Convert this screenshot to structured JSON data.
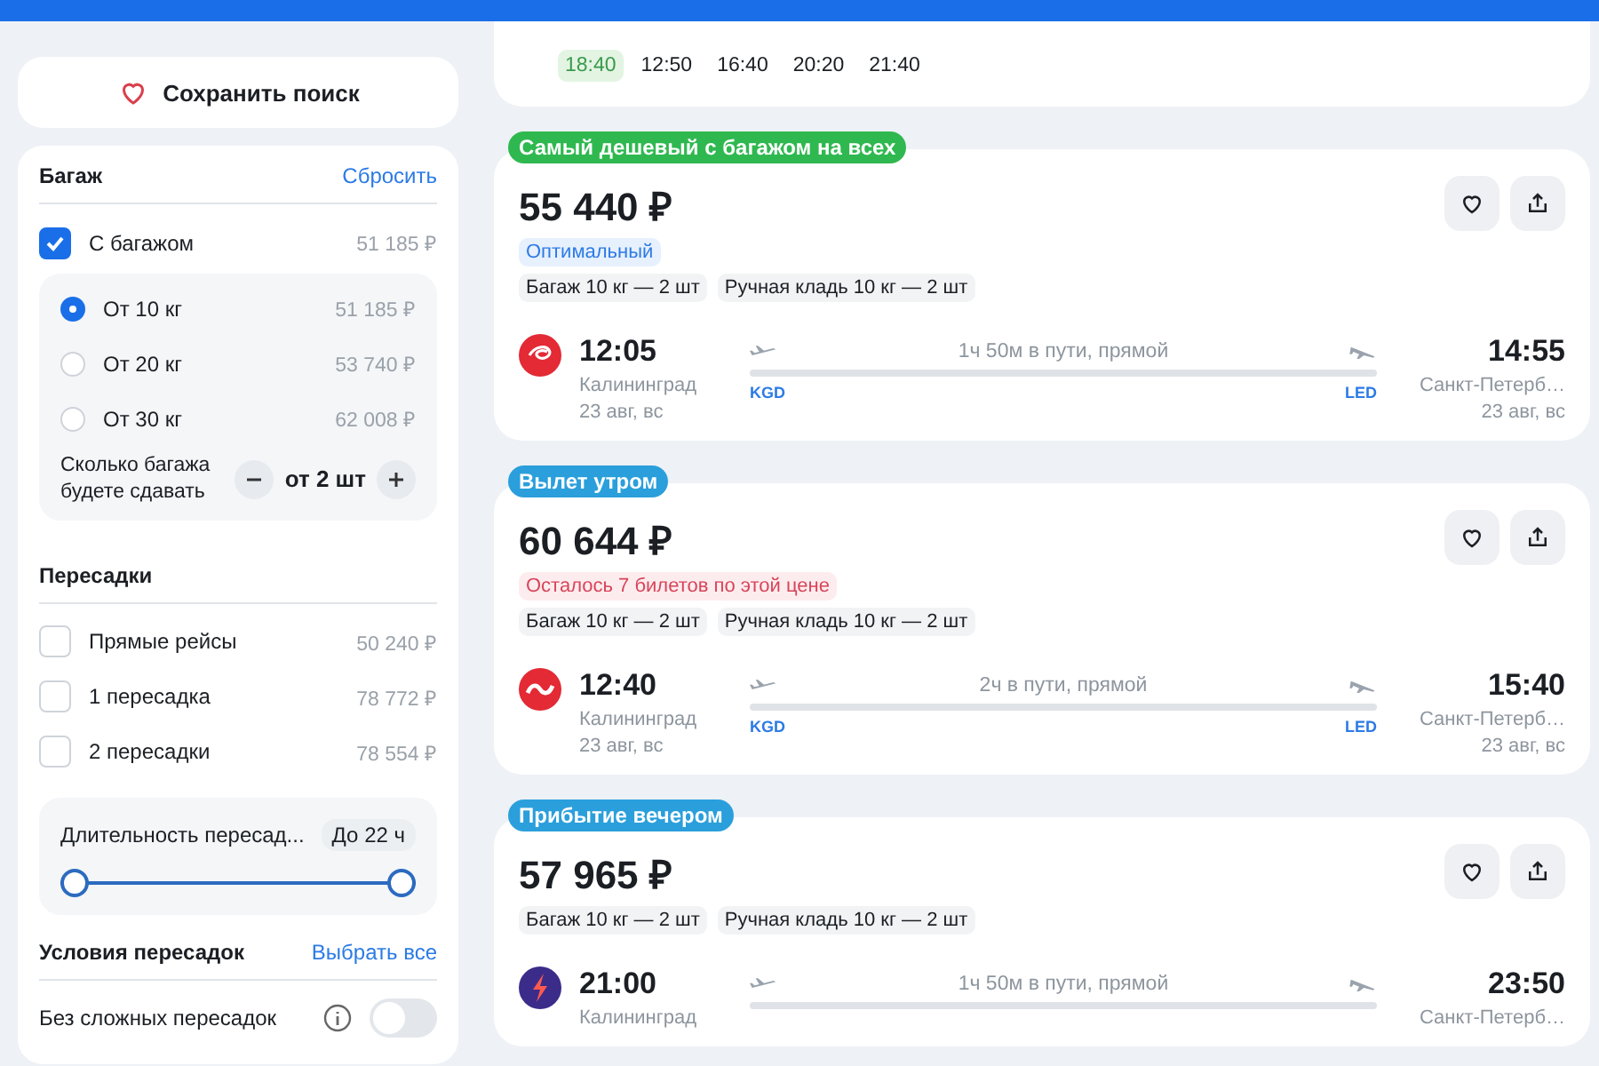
{
  "prev_card": {
    "times": [
      {
        "label": "18:40",
        "selected": true
      },
      {
        "label": "12:50",
        "selected": false
      },
      {
        "label": "16:40",
        "selected": false
      },
      {
        "label": "20:20",
        "selected": false
      },
      {
        "label": "21:40",
        "selected": false
      }
    ]
  },
  "sidebar": {
    "save_button": "Сохранить поиск",
    "baggage": {
      "title": "Багаж",
      "reset": "Сбросить",
      "with_baggage": {
        "label": "С багажом",
        "price": "51 185 ₽",
        "checked": true
      },
      "weights": [
        {
          "label": "От 10 кг",
          "price": "51 185 ₽",
          "selected": true
        },
        {
          "label": "От 20 кг",
          "price": "53 740 ₽",
          "selected": false
        },
        {
          "label": "От 30 кг",
          "price": "62 008 ₽",
          "selected": false
        }
      ],
      "count_label": "Сколько багажа будете сдавать",
      "count_value": "от 2 шт"
    },
    "transfers": {
      "title": "Пересадки",
      "options": [
        {
          "label": "Прямые рейсы",
          "price": "50 240 ₽",
          "checked": false
        },
        {
          "label": "1 пересадка",
          "price": "78 772 ₽",
          "checked": false
        },
        {
          "label": "2 пересадки",
          "price": "78 554 ₽",
          "checked": false
        }
      ],
      "duration": {
        "label": "Длительность пересад...",
        "value": "До 22 ч",
        "level": 1
      }
    },
    "conditions": {
      "title": "Условия пересадок",
      "select_all": "Выбрать все",
      "items": [
        {
          "label": "Без сложных пересадок",
          "on": false
        }
      ]
    }
  },
  "tickets": [
    {
      "badge": "Самый дешевый с багажом на всех",
      "color": "#2fb84f",
      "price": "55 440 ₽",
      "notes": [
        {
          "kind": "optimal",
          "text": "Оптимальный"
        }
      ],
      "baggage": [
        "Багаж 10 кг — 2 шт",
        "Ручная кладь 10 кг — 2 шт"
      ],
      "depart": {
        "time": "12:05",
        "city": "Калининград",
        "date": "23 авг, вс",
        "code": "KGD"
      },
      "duration": "1ч 50м в пути, прямой",
      "arrive": {
        "time": "14:55",
        "city": "Санкт-Петерб…",
        "date": "23 авг, вс",
        "code": "LED"
      }
    },
    {
      "badge": "Вылет утром",
      "color": "#2a9fdc",
      "price": "60 644 ₽",
      "notes": [
        {
          "kind": "warning",
          "text": "Осталось 7 билетов по этой цене"
        }
      ],
      "baggage": [
        "Багаж 10 кг — 2 шт",
        "Ручная кладь 10 кг — 2 шт"
      ],
      "depart": {
        "time": "12:40",
        "city": "Калининград",
        "date": "23 авг, вс",
        "code": "KGD"
      },
      "duration": "2ч в пути, прямой",
      "arrive": {
        "time": "15:40",
        "city": "Санкт-Петерб…",
        "date": "23 авг, вс",
        "code": "LED"
      }
    },
    {
      "badge": "Прибытие вечером",
      "color": "#2a9fdc",
      "price": "57 965 ₽",
      "baggage": [
        "Багаж 10 кг — 2 шт",
        "Ручная кладь 10 кг — 2 шт"
      ],
      "depart": {
        "time": "21:00",
        "city": "Калининград"
      },
      "duration": "1ч 50м в пути, прямой",
      "arrive": {
        "time": "23:50",
        "city": "Санкт-Петерб…"
      }
    }
  ]
}
